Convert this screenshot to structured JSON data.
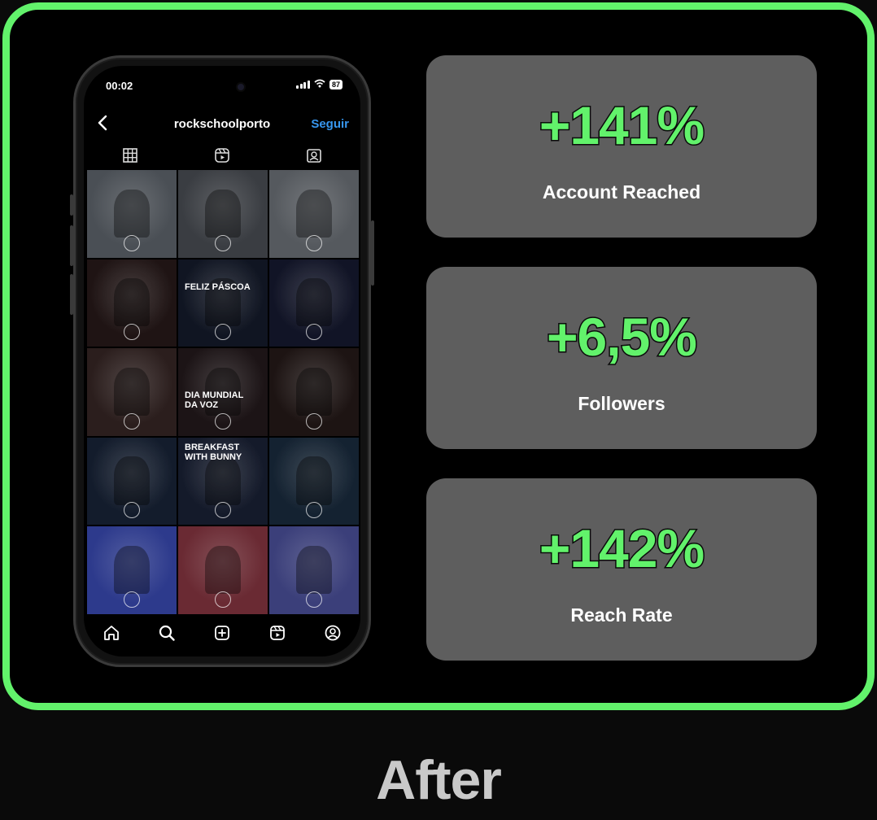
{
  "phone": {
    "status_time": "00:02",
    "battery": "87",
    "username": "rockschoolporto",
    "follow_label": "Seguir",
    "tiles": [
      {
        "bg": "#4a4f55",
        "caption": "",
        "icon": "photo-musician-guitar"
      },
      {
        "bg": "#3a3d42",
        "caption": "",
        "icon": "photo-band-wall"
      },
      {
        "bg": "#55595e",
        "caption": "",
        "icon": "photo-student-guitar"
      },
      {
        "bg": "#1f1414",
        "caption": "",
        "icon": "photo-singer-red"
      },
      {
        "bg": "#101522",
        "caption": "FELIZ PÁSCOA",
        "icon": "post-easter"
      },
      {
        "bg": "#111426",
        "caption": "",
        "icon": "photo-guitar-stage"
      },
      {
        "bg": "#2b1e1d",
        "caption": "",
        "icon": "photo-singers-group"
      },
      {
        "bg": "#1c1416",
        "caption": "DIA MUNDIAL DA VOZ",
        "icon": "post-voice-day"
      },
      {
        "bg": "#1d1413",
        "caption": "",
        "icon": "photo-guitarist-dark"
      },
      {
        "bg": "#131c2c",
        "caption": "",
        "icon": "photo-drums-stage"
      },
      {
        "bg": "#141a2a",
        "caption": "BREAKFAST WITH BUNNY",
        "icon": "post-breakfast"
      },
      {
        "bg": "#142231",
        "caption": "",
        "icon": "photo-guitarist-blue"
      },
      {
        "bg": "#2d3a8c",
        "caption": "",
        "icon": "photo-singer-purple"
      },
      {
        "bg": "#6a2a33",
        "caption": "",
        "icon": "photo-drums-neon"
      },
      {
        "bg": "#3b3f7a",
        "caption": "",
        "icon": "photo-guitarist-club"
      }
    ]
  },
  "stats": [
    {
      "value": "+141%",
      "label": "Account Reached"
    },
    {
      "value": "+6,5%",
      "label": "Followers"
    },
    {
      "value": "+142%",
      "label": "Reach Rate"
    }
  ],
  "caption": "After",
  "colors": {
    "accent": "#62f26b",
    "card": "#5e5e5e",
    "follow": "#3797f0"
  }
}
